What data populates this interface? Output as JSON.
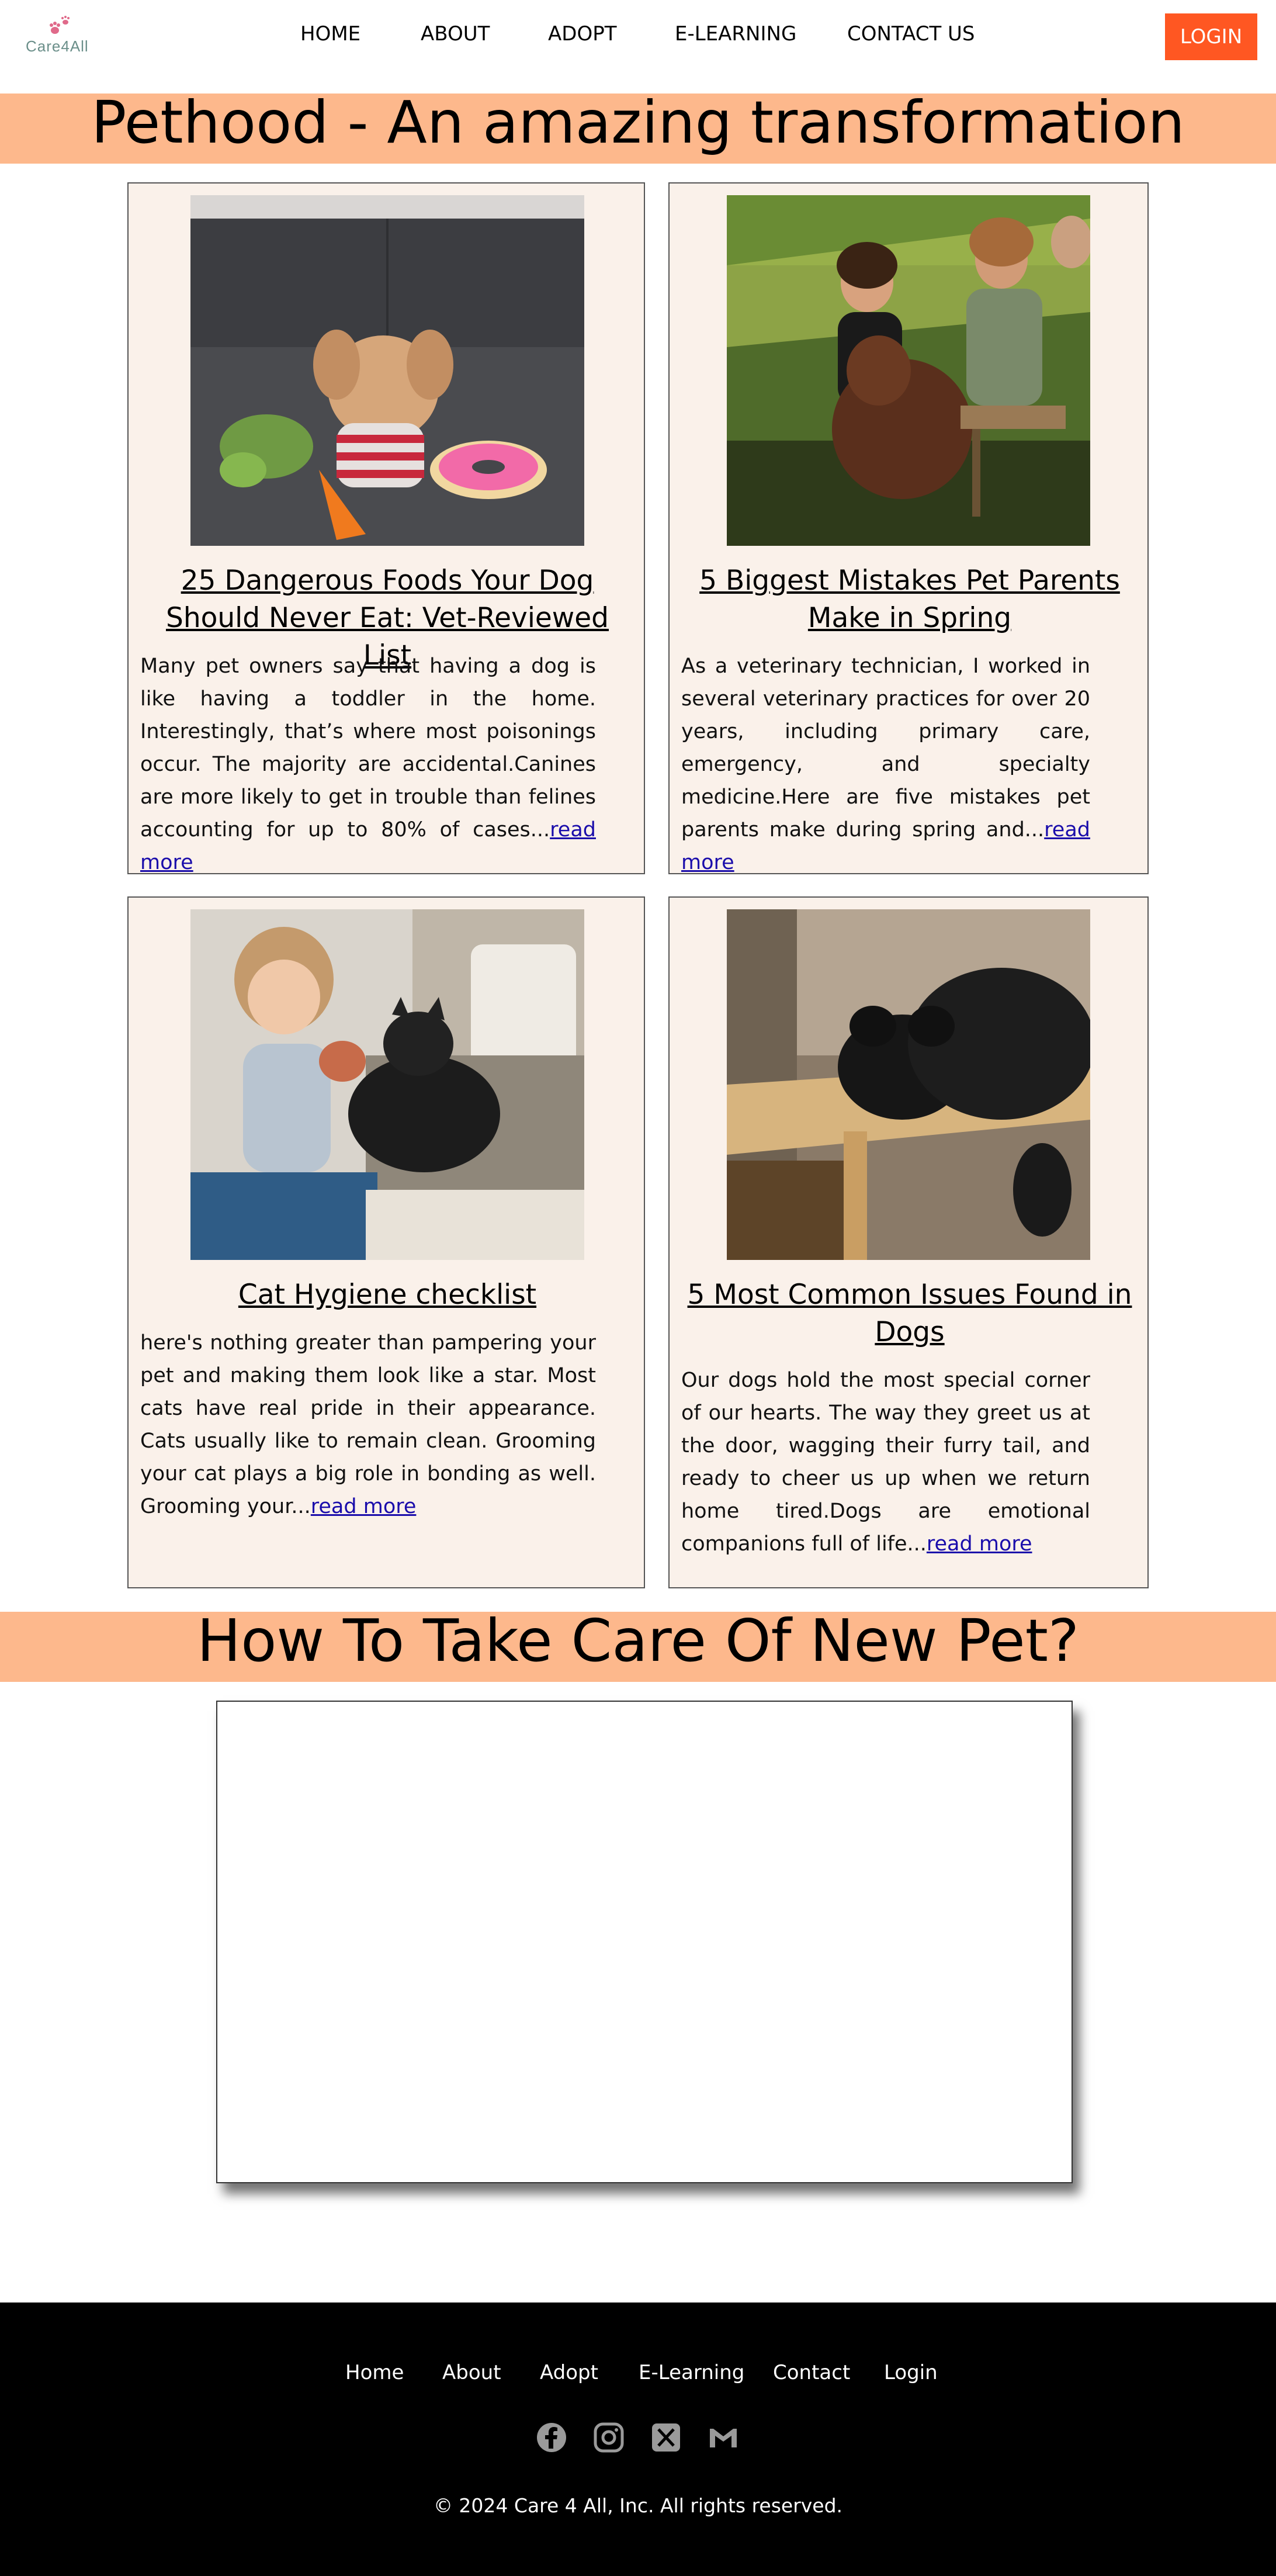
{
  "nav": {
    "logo_text": "Care4All",
    "links": [
      "HOME",
      "ABOUT",
      "ADOPT",
      "E-LEARNING",
      "CONTACT US"
    ],
    "login_label": "LOGIN",
    "login_color": "#ff5722"
  },
  "banners": {
    "blog_title": "Pethood - An amazing transformation",
    "care_title": "How To Take Care Of New Pet?",
    "color": "#fdb88c"
  },
  "articles": [
    {
      "title": "25 Dangerous Foods Your Dog Should Never Eat: Vet-Reviewed List",
      "excerpt": "Many pet owners say that having a dog is like having a toddler in the home. Interestingly, that’s where most poisonings occur. The majority are accidental.Canines are more likely to get in trouble than felines accounting for up to 80% of cases...",
      "link": "read more",
      "image": "dog-with-toys-photo"
    },
    {
      "title": "5 Biggest Mistakes Pet Parents Make in Spring",
      "excerpt": "As a veterinary technician, I worked in several veterinary practices for over 20 years, including primary care, emergency, and specialty medicine.Here are five mistakes pet parents make during spring and...",
      "link": "read more",
      "image": "friends-with-dog-photo"
    },
    {
      "title": "Cat Hygiene checklist",
      "excerpt": "here's nothing greater than pampering your pet and making them look like a star. Most cats have real pride in their appearance. Cats usually like to remain clean. Grooming your cat plays a big role in bonding as well. Grooming your...",
      "link": "read more",
      "image": "child-with-cat-photo"
    },
    {
      "title": "5 Most Common Issues Found in Dogs",
      "excerpt": "Our dogs hold the most special corner of our hearts. The way they greet us at the door, wagging their furry tail, and ready to cheer us up when we return home tired.Dogs are emotional companions full of life...",
      "link": "read more",
      "image": "pug-on-bench-photo"
    }
  ],
  "footer": {
    "links": [
      "Home",
      "About",
      "Adopt",
      "E-Learning",
      "Contact",
      "Login"
    ],
    "social_icons": [
      "facebook-icon",
      "instagram-icon",
      "x-icon",
      "gmail-icon"
    ],
    "copyright": "© 2024 Care 4 All, Inc. All rights reserved."
  }
}
